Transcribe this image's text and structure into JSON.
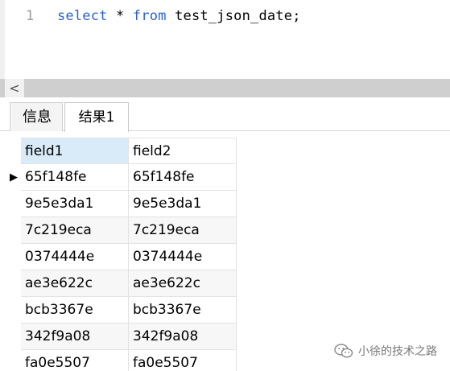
{
  "editor": {
    "line_number": "1",
    "tokens": {
      "kw1": "select",
      "star": " * ",
      "kw2": "from",
      "rest": " test_json_date;"
    }
  },
  "scrollbar": {
    "left_arrow": "<"
  },
  "tabs": [
    {
      "label": "信息"
    },
    {
      "label": "结果1"
    }
  ],
  "grid": {
    "columns": [
      "field1",
      "field2"
    ],
    "current_row_marker": "▶",
    "rows": [
      [
        "65f148fe",
        "65f148fe"
      ],
      [
        "9e5e3da1",
        "9e5e3da1"
      ],
      [
        "7c219eca",
        "7c219eca"
      ],
      [
        "0374444e",
        "0374444e"
      ],
      [
        "ae3e622c",
        "ae3e622c"
      ],
      [
        "bcb3367e",
        "bcb3367e"
      ],
      [
        "342f9a08",
        "342f9a08"
      ],
      [
        "fa0e5507",
        "fa0e5507"
      ]
    ]
  },
  "watermark": {
    "text": "小徐的技术之路"
  },
  "colors": {
    "keyword": "#2a63d0",
    "header_selected": "#d9ebf9",
    "scrollbar": "#cfcfcf"
  }
}
